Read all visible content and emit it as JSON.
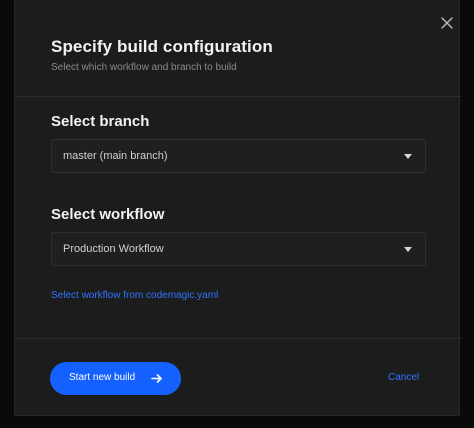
{
  "dialog": {
    "title": "Specify build configuration",
    "subtitle": "Select which workflow and branch to build",
    "close_icon": "close-icon"
  },
  "branch": {
    "label": "Select branch",
    "selected": "master (main branch)",
    "caret_icon": "caret-down-icon"
  },
  "workflow": {
    "label": "Select workflow",
    "selected": "Production Workflow",
    "caret_icon": "caret-down-icon",
    "yaml_link": "Select workflow from codemagic.yaml"
  },
  "footer": {
    "start_label": "Start new build",
    "start_icon": "arrow-right-icon",
    "cancel_label": "Cancel"
  },
  "colors": {
    "accent": "#1561ff",
    "link": "#2f73ff",
    "panel": "#1c1c1c"
  }
}
